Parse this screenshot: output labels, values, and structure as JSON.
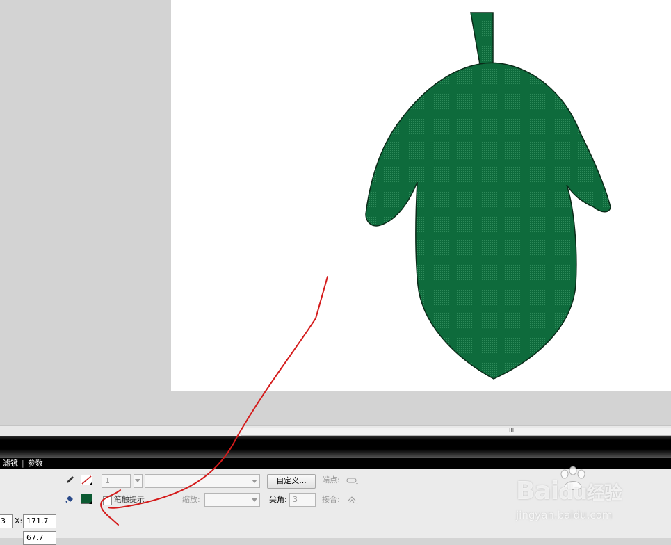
{
  "stage": {
    "canvas_color": "#ffffff",
    "pasteboard_color": "#d3d3d3",
    "leaf_fill": "#0e6b3c",
    "leaf_outline": "#0a2a18"
  },
  "panel_tabs": {
    "tab1": "滤镜",
    "tab2": "参数"
  },
  "properties": {
    "stroke_icon": "pencil-icon",
    "fill_icon": "paint-bucket-icon",
    "stroke_color": "#cc2222",
    "fill_color": "#0b5a32",
    "stroke_height": "1",
    "stroke_style": "",
    "custom_button": "自定义...",
    "cap_label": "端点:",
    "hinting_label": "笔触提示",
    "scale_label": "缩放:",
    "scale_value": "",
    "miter_label": "尖角:",
    "miter_value": "3",
    "join_label": "接合:"
  },
  "position": {
    "w_value": "3",
    "x_label": "X:",
    "x_value": "171.7",
    "y_value": "67.7"
  },
  "watermark": {
    "brand": "Bai",
    "brand_tail": "经验",
    "url": "jingyan.baidu.com"
  }
}
